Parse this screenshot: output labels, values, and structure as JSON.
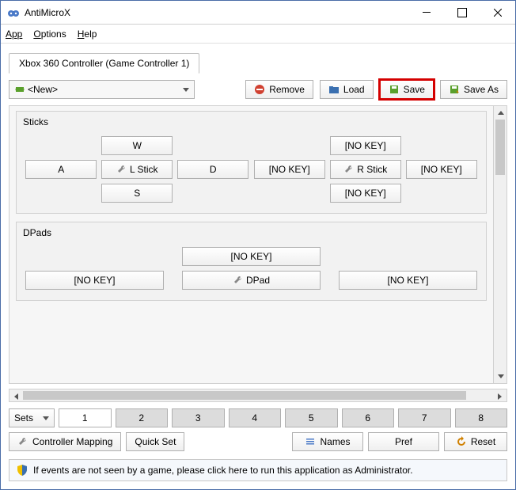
{
  "title": "AntiMicroX",
  "menu": {
    "app": "App",
    "options": "Options",
    "help": "Help"
  },
  "tab": "Xbox 360 Controller (Game Controller 1)",
  "profile": {
    "selected": "<New>"
  },
  "toolbar": {
    "remove": "Remove",
    "load": "Load",
    "save": "Save",
    "save_as": "Save As"
  },
  "groups": {
    "sticks": {
      "title": "Sticks",
      "left": {
        "up": "W",
        "left": "A",
        "center": "L Stick",
        "right": "D",
        "down": "S"
      },
      "right": {
        "up": "[NO KEY]",
        "left": "[NO KEY]",
        "center": "R Stick",
        "right": "[NO KEY]",
        "down": "[NO KEY]"
      }
    },
    "dpads": {
      "title": "DPads",
      "up": "[NO KEY]",
      "left": "[NO KEY]",
      "center": "DPad",
      "right": "[NO KEY]"
    }
  },
  "sets": {
    "label": "Sets",
    "buttons": [
      "1",
      "2",
      "3",
      "4",
      "5",
      "6",
      "7",
      "8"
    ],
    "active_index": 0
  },
  "controls": {
    "mapping": "Controller Mapping",
    "quickset": "Quick Set",
    "names": "Names",
    "pref": "Pref",
    "reset": "Reset"
  },
  "status": "If events are not seen by a game, please click here to run this application as Administrator."
}
